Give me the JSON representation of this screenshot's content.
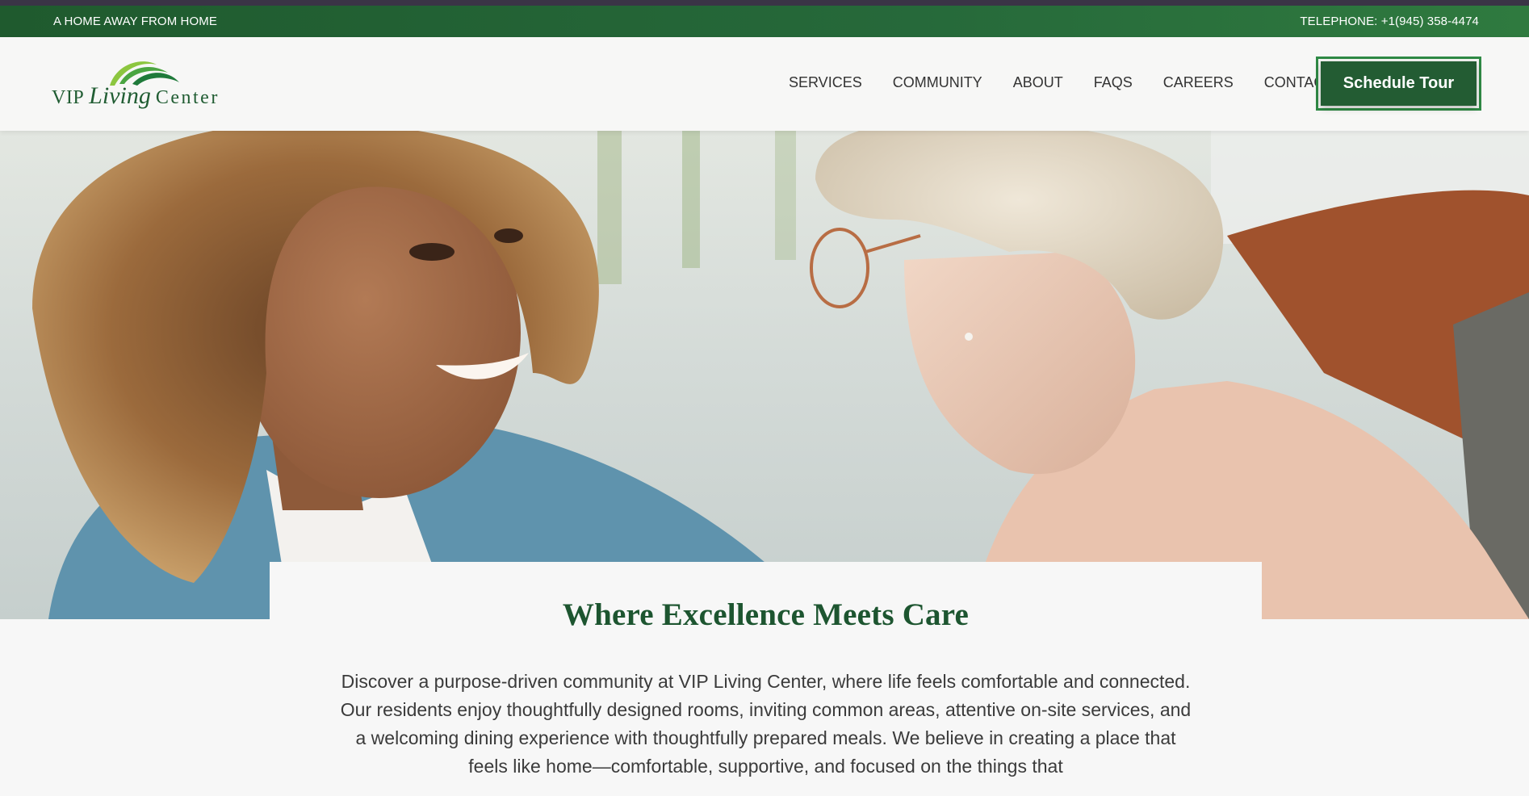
{
  "topbar": {
    "tagline": "A HOME AWAY FROM HOME",
    "phone": "TELEPHONE: +1(945) 358-4474"
  },
  "logo": {
    "word1": "VIP",
    "word2": "Living",
    "word3": "Center"
  },
  "nav": {
    "items": [
      {
        "label": "SERVICES"
      },
      {
        "label": "COMMUNITY"
      },
      {
        "label": "ABOUT"
      },
      {
        "label": "FAQS"
      },
      {
        "label": "CAREERS"
      },
      {
        "label": "CONTACT"
      }
    ]
  },
  "cta": {
    "label": "Schedule Tour"
  },
  "intro": {
    "heading": "Where Excellence Meets Care",
    "body": "Discover a purpose-driven community at VIP Living Center, where life feels comfortable and connected. Our residents enjoy thoughtfully designed rooms, inviting common areas, attentive on-site services, and a welcoming dining experience with thoughtfully prepared meals. We believe in creating a place that feels like home—comfortable, supportive, and focused on the things that"
  },
  "colors": {
    "brand_green": "#235c33",
    "accent_green": "#2f8a45",
    "text": "#3b3b3b"
  }
}
